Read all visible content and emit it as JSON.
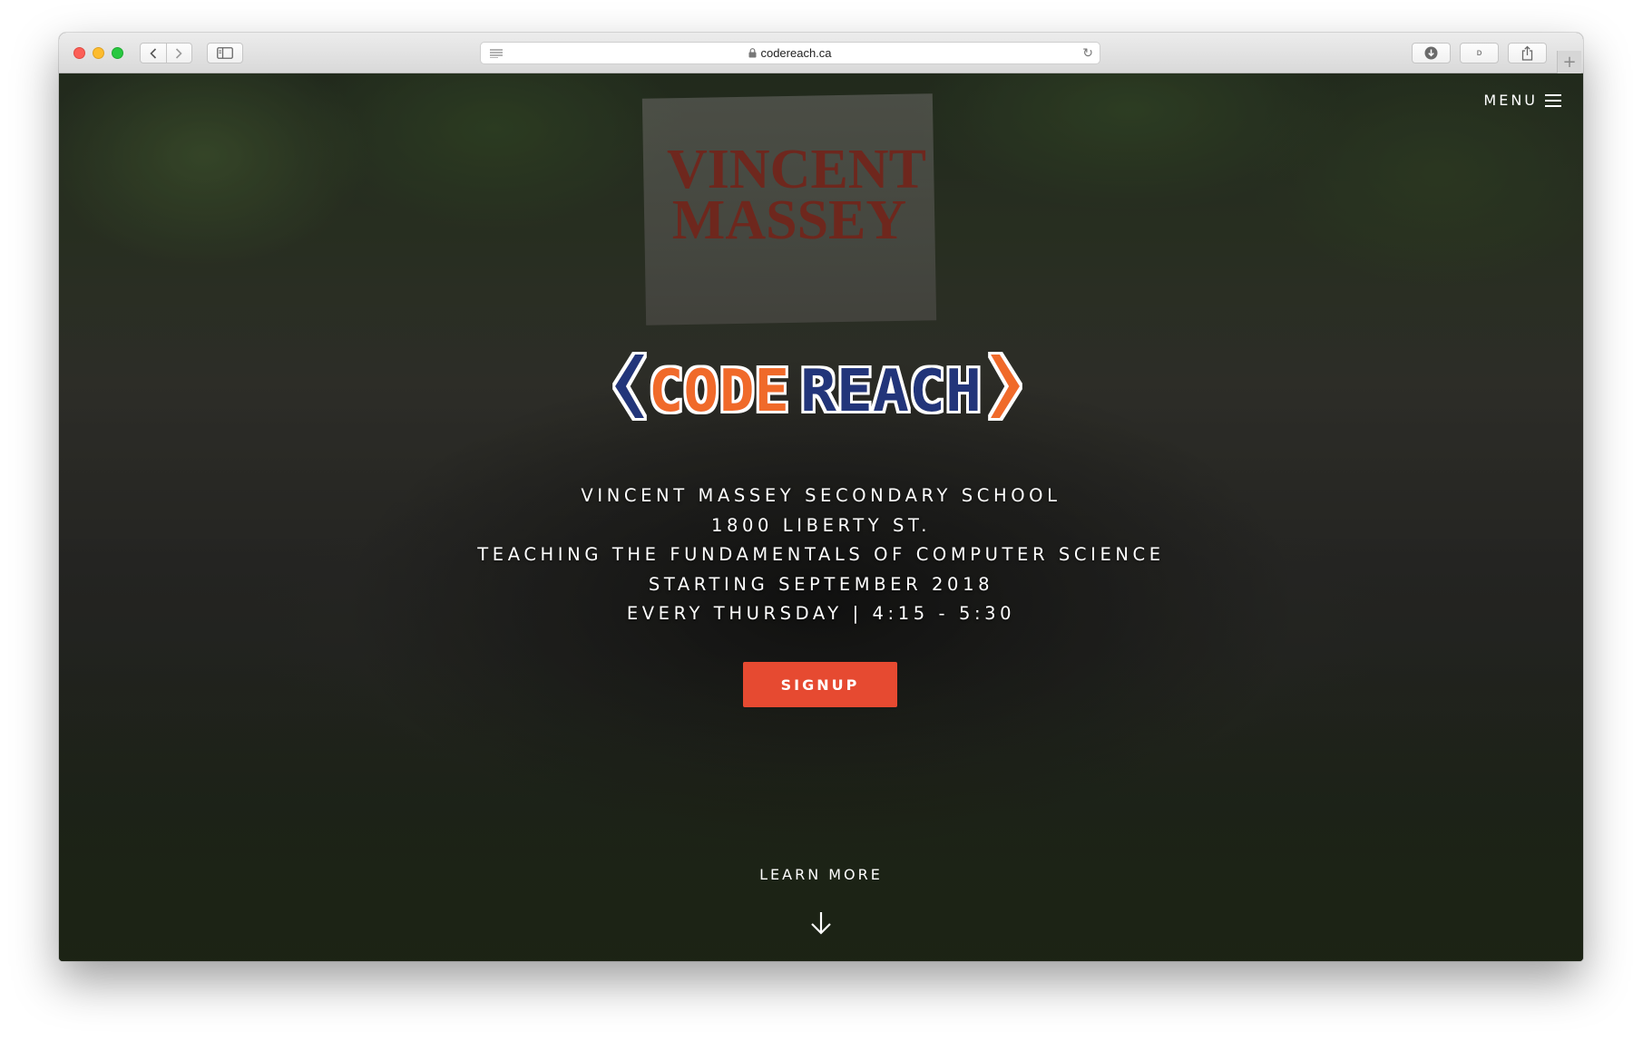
{
  "browser": {
    "url": "codereach.ca",
    "reader_label": "ᴅ",
    "new_tab_label": "+"
  },
  "nav": {
    "menu_label": "MENU"
  },
  "hero": {
    "logo_text_left": "CO",
    "logo_text_mid": "DE",
    "logo_text_right": "REACH",
    "background_sign_text": "VINCENT\nMASSEY",
    "lines": [
      "VINCENT MASSEY SECONDARY SCHOOL",
      "1800 LIBERTY ST.",
      "TEACHING THE FUNDAMENTALS OF COMPUTER SCIENCE",
      "STARTING SEPTEMBER 2018",
      "EVERY THURSDAY | 4:15 - 5:30"
    ],
    "signup_label": "SIGNUP",
    "learn_more_label": "LEARN MORE"
  },
  "colors": {
    "accent": "#e64a31",
    "logo_orange": "#f06a2a",
    "logo_navy": "#23357a"
  }
}
